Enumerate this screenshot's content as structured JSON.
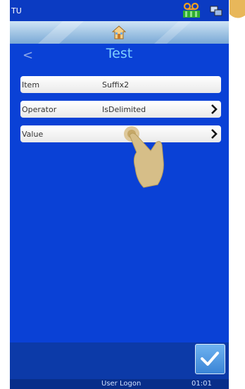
{
  "status_bar": {
    "title": "TU",
    "icons": [
      "voicemail-icon",
      "network-icon"
    ]
  },
  "toolbar": {
    "icon": "home-icon"
  },
  "header": {
    "back_symbol": "<",
    "title": "Test"
  },
  "rows": [
    {
      "label": "Item",
      "value": "Suffix2",
      "has_chevron": false
    },
    {
      "label": "Operator",
      "value": "IsDelimited",
      "has_chevron": true
    },
    {
      "label": "Value",
      "value": "",
      "has_chevron": true
    }
  ],
  "footer": {
    "user_logon": "User Logon",
    "time": "01:01",
    "ok_icon": "checkmark-icon"
  },
  "colors": {
    "background": "#0a41d6",
    "header_title": "#7fd0ff",
    "accent_button": "#3a84d6",
    "row": "#ffffff"
  }
}
